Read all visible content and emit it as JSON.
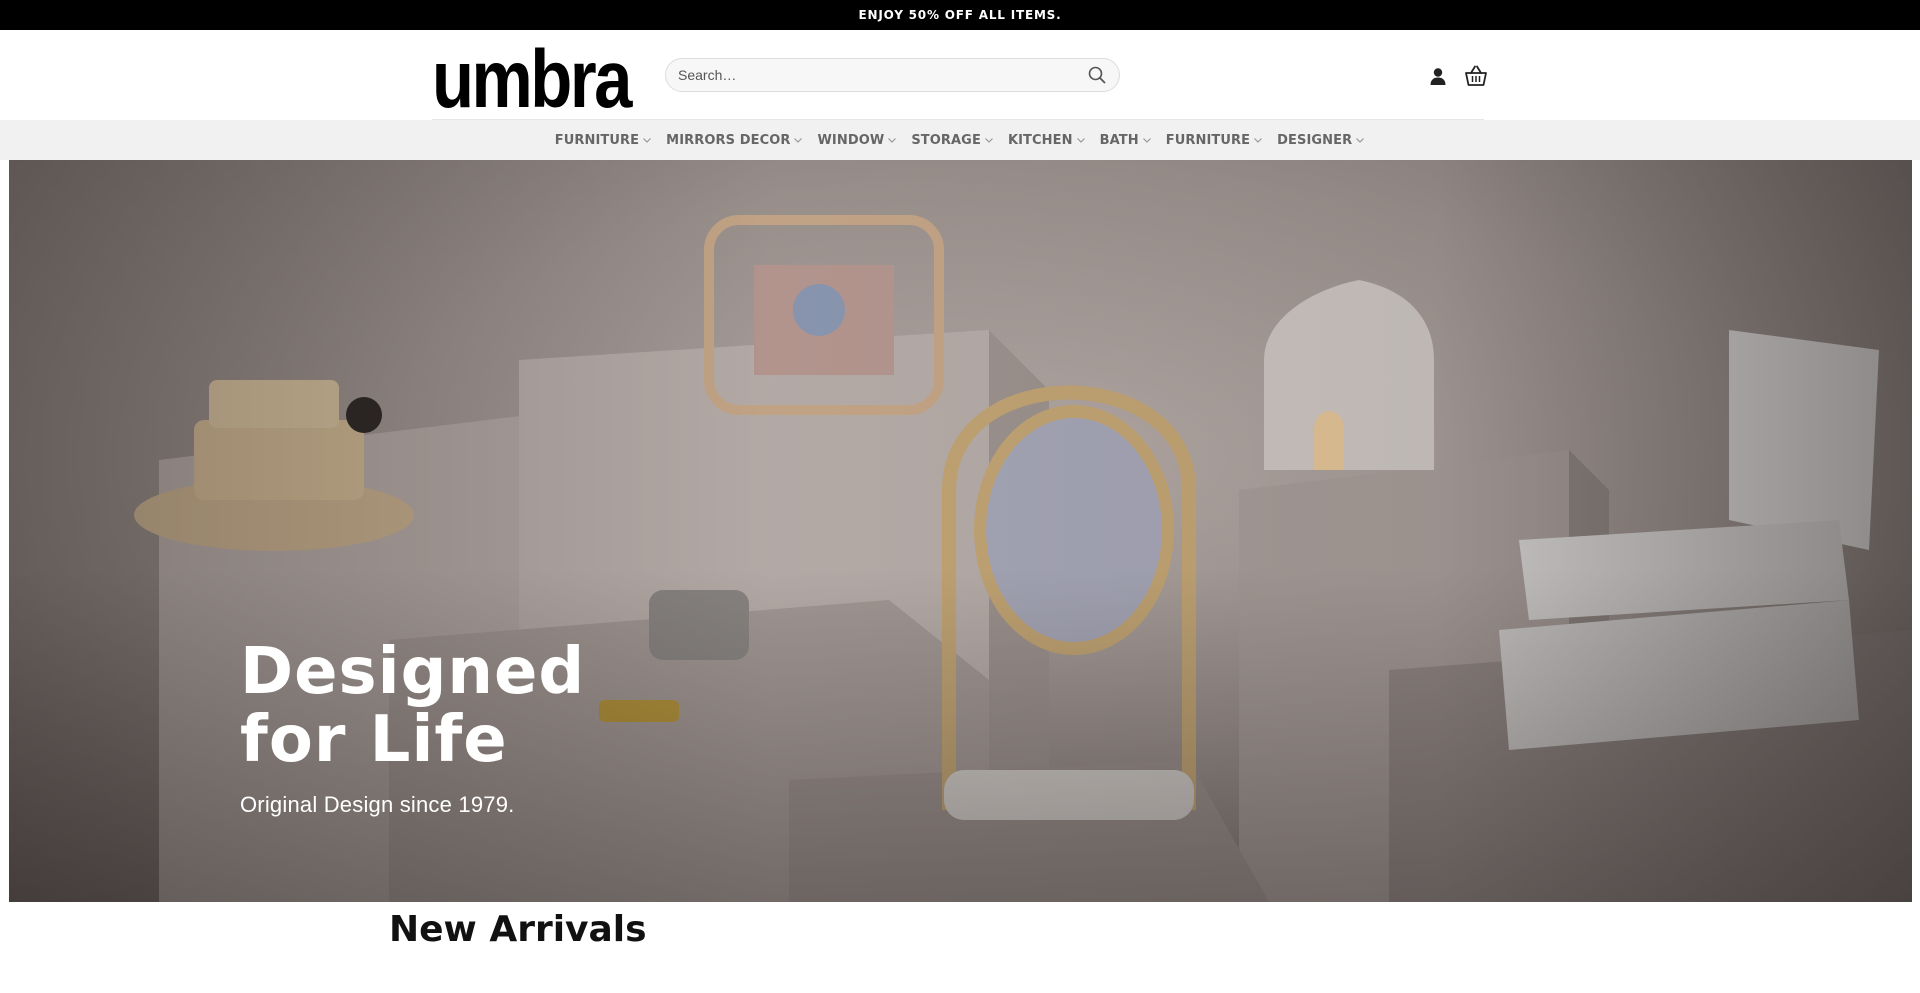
{
  "announcement": {
    "text": "ENJOY 50% OFF ALL ITEMS."
  },
  "header": {
    "logo": "umbra",
    "search": {
      "placeholder": "Search…",
      "value": ""
    },
    "icons": [
      "search-icon",
      "account-icon",
      "cart-icon"
    ]
  },
  "nav": {
    "items": [
      {
        "label": "FURNITURE"
      },
      {
        "label": "MIRRORS DECOR"
      },
      {
        "label": "WINDOW"
      },
      {
        "label": "STORAGE"
      },
      {
        "label": "KITCHEN"
      },
      {
        "label": "BATH"
      },
      {
        "label": "FURNITURE"
      },
      {
        "label": "DESIGNER"
      }
    ]
  },
  "hero": {
    "title_line1": "Designed",
    "title_line2": "for Life",
    "subtitle": "Original Design since 1979."
  },
  "sections": {
    "new_arrivals_title": "New Arrivals"
  },
  "colors": {
    "announcement_bg": "#000000",
    "nav_bg": "#f1f1f1",
    "nav_text": "#666666",
    "hero_text": "#ffffff"
  }
}
